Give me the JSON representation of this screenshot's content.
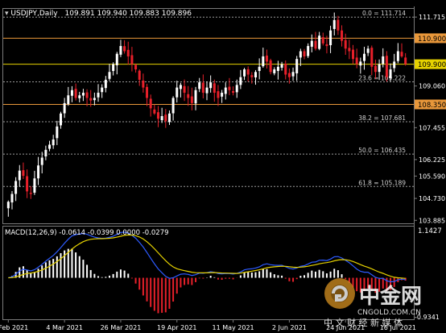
{
  "header": {
    "symbol": "USDJPY,Daily",
    "ohlc": "109.891 109.940 109.883 109.896"
  },
  "macd": {
    "label": "MACD(12,26,9) -0.0614 -0.0399 0.0000 -0.0279",
    "top_value": "1.1427",
    "bottom_value": "-0.9341"
  },
  "watermark": {
    "brand": "中金网",
    "domain": "CNGOLD.COM.CN",
    "tagline": "中 文 财 经 新 媒 体"
  },
  "colors": {
    "background": "#000000",
    "bull_candle": "#ffffff",
    "bear_candle": "#e8202a",
    "resistance_line": "#e8973a",
    "mid_line": "#e6d200",
    "fib_line": "#9a9a9a",
    "macd_signal": "#e6d200",
    "macd_line": "#2d5bff",
    "macd_hist_pos": "#ffffff",
    "macd_hist_neg": "#e8202a",
    "axis_text": "#ffffff"
  },
  "chart_data": {
    "type": "candlestick",
    "symbol": "USDJPY",
    "timeframe": "Daily",
    "ylim": [
      103.8,
      112.0
    ],
    "y_ticks": [
      111.715,
      110.9,
      109.9,
      109.06,
      108.35,
      107.455,
      106.225,
      105.59,
      104.73,
      103.885
    ],
    "y_tick_labels": [
      "111.715",
      "110.900",
      "109.900",
      "109.060",
      "108.350",
      "107.455",
      "106.225",
      "105.590",
      "104.730",
      "103.885"
    ],
    "x_labels": [
      "10 Feb 2021",
      "4 Mar 2021",
      "26 Mar 2021",
      "19 Apr 2021",
      "11 May 2021",
      "2 Jun 2021",
      "24 Jun 2021",
      "16 Jul 2021"
    ],
    "horizontal_levels": [
      {
        "value": 110.9,
        "label": "110.900",
        "style": "resistance"
      },
      {
        "value": 109.9,
        "label": "109.900",
        "style": "mid"
      },
      {
        "value": 108.35,
        "label": "108.350",
        "style": "resistance"
      }
    ],
    "fibonacci_levels": [
      {
        "ratio": "0.0",
        "value": 111.714,
        "text": "0.0 = 111.714"
      },
      {
        "ratio": "23.6",
        "value": 109.222,
        "text": "23.6 = 109.222"
      },
      {
        "ratio": "38.2",
        "value": 107.681,
        "text": "38.2 = 107.681"
      },
      {
        "ratio": "50.0",
        "value": 106.435,
        "text": "50.0 = 106.435"
      },
      {
        "ratio": "61.8",
        "value": 105.189,
        "text": "61.8 = 105.189"
      }
    ],
    "close_path": [
      104.6,
      104.9,
      105.4,
      105.8,
      105.6,
      105.0,
      104.9,
      105.5,
      106.0,
      106.3,
      106.6,
      106.8,
      107.0,
      107.5,
      108.0,
      108.4,
      108.7,
      108.9,
      108.6,
      108.7,
      108.8,
      108.6,
      108.5,
      108.6,
      108.8,
      109.0,
      109.3,
      109.6,
      109.9,
      110.3,
      110.6,
      110.4,
      110.2,
      109.9,
      109.7,
      109.3,
      109.0,
      108.6,
      108.2,
      108.0,
      107.8,
      107.9,
      107.7,
      108.0,
      108.6,
      109.0,
      109.1,
      108.8,
      108.6,
      108.4,
      108.9,
      109.2,
      108.8,
      109.0,
      109.2,
      108.8,
      108.6,
      108.8,
      109.0,
      108.9,
      108.8,
      109.1,
      109.4,
      109.7,
      109.5,
      109.4,
      109.6,
      109.8,
      110.2,
      110.0,
      109.6,
      109.7,
      109.8,
      109.9,
      109.5,
      109.4,
      109.6,
      110.1,
      110.4,
      110.2,
      110.6,
      110.8,
      110.5,
      111.0,
      110.7,
      110.6,
      111.2,
      111.6,
      111.2,
      110.8,
      110.5,
      110.4,
      110.1,
      109.9,
      110.0,
      110.3,
      110.5,
      109.8,
      109.6,
      109.9,
      110.2,
      109.4,
      109.7,
      110.0,
      110.4,
      110.2,
      109.9
    ]
  }
}
